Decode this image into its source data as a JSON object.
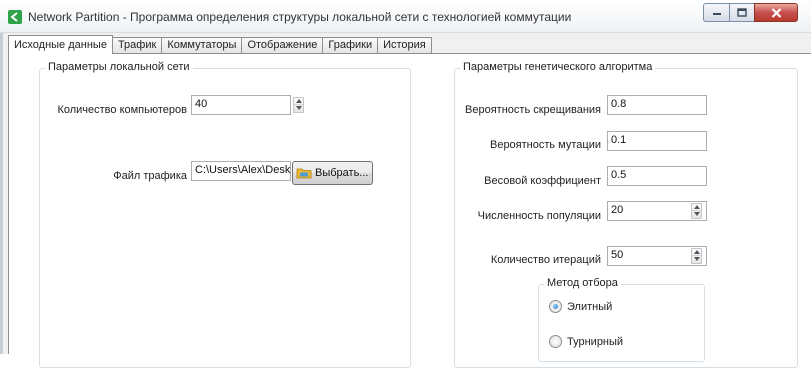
{
  "window": {
    "title": "Network Partition - Программа определения структуры локальной сети с технологией коммутации"
  },
  "tabs": [
    {
      "label": "Исходные данные",
      "active": true
    },
    {
      "label": "Трафик",
      "active": false
    },
    {
      "label": "Коммутаторы",
      "active": false
    },
    {
      "label": "Отображение",
      "active": false
    },
    {
      "label": "Графики",
      "active": false
    },
    {
      "label": "История",
      "active": false
    }
  ],
  "local_network": {
    "title": "Параметры локальной сети",
    "computers_label": "Количество компьютеров",
    "computers_value": "40",
    "traffic_file_label": "Файл трафика",
    "traffic_file_value": "C:\\Users\\Alex\\Desktop\\",
    "browse_label": "Выбрать..."
  },
  "genetic": {
    "title": "Параметры генетического алгоритма",
    "crossover_label": "Вероятность скрещивания",
    "crossover_value": "0.8",
    "mutation_label": "Вероятность мутации",
    "mutation_value": "0.1",
    "weight_label": "Весовой коэффициент",
    "weight_value": "0.5",
    "population_label": "Численность популяции",
    "population_value": "20",
    "iterations_label": "Количество итераций",
    "iterations_value": "50",
    "selection": {
      "title": "Метод отбора",
      "options": [
        {
          "label": "Элитный",
          "checked": true
        },
        {
          "label": "Турнирный",
          "checked": false
        }
      ]
    }
  },
  "colors": {
    "app_icon": "#2fa24a",
    "close_button": "#c75050",
    "window_bg": "#f0f0f0",
    "radio_selected": "#1a6fc4"
  }
}
